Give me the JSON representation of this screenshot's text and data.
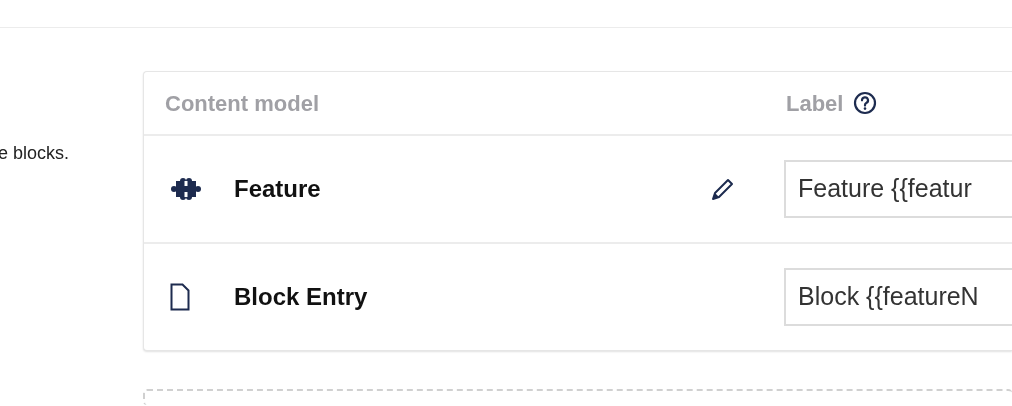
{
  "description_fragment": "e blocks.",
  "table": {
    "columns": [
      "Content model",
      "Label"
    ],
    "rows": [
      {
        "kind": "puzzle",
        "name": "Feature",
        "editable": true,
        "label_value": "Feature {{featur"
      },
      {
        "kind": "document",
        "name": "Block Entry",
        "editable": false,
        "label_value": "Block {{featureN"
      }
    ]
  }
}
